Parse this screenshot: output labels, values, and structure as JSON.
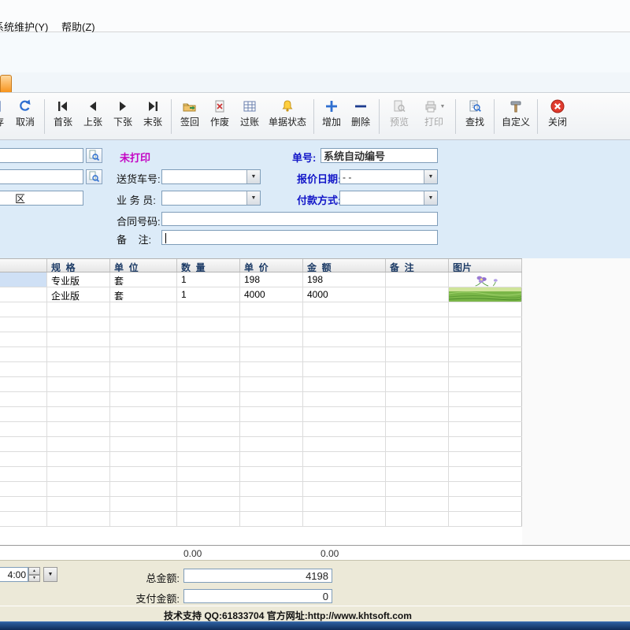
{
  "window": {
    "menu": [
      {
        "label": "系统维护(Y)"
      },
      {
        "label": "帮助(Z)"
      }
    ]
  },
  "toolbar": {
    "buttons": [
      {
        "id": "save",
        "label": "保存",
        "icon": "floppy-icon",
        "enabled": true
      },
      {
        "id": "cancel",
        "label": "取消",
        "icon": "undo-arrow-icon",
        "enabled": true
      },
      {
        "id": "first",
        "label": "首张",
        "icon": "first-record-icon",
        "enabled": true
      },
      {
        "id": "prev",
        "label": "上张",
        "icon": "prev-record-icon",
        "enabled": true
      },
      {
        "id": "next",
        "label": "下张",
        "icon": "next-record-icon",
        "enabled": true
      },
      {
        "id": "last",
        "label": "末张",
        "icon": "last-record-icon",
        "enabled": true
      },
      {
        "id": "sign-back",
        "label": "签回",
        "icon": "folder-return-icon",
        "enabled": true
      },
      {
        "id": "void",
        "label": "作废",
        "icon": "void-document-icon",
        "enabled": true
      },
      {
        "id": "post",
        "label": "过账",
        "icon": "ledger-grid-icon",
        "enabled": true
      },
      {
        "id": "doc-status",
        "label": "单据状态",
        "icon": "bell-icon",
        "enabled": true
      },
      {
        "id": "add",
        "label": "增加",
        "icon": "plus-icon",
        "enabled": true
      },
      {
        "id": "delete",
        "label": "删除",
        "icon": "minus-icon",
        "enabled": true
      },
      {
        "id": "preview",
        "label": "预览",
        "icon": "preview-icon",
        "enabled": false
      },
      {
        "id": "print",
        "label": "打印",
        "icon": "printer-icon",
        "enabled": false
      },
      {
        "id": "find",
        "label": "查找",
        "icon": "search-document-icon",
        "enabled": true
      },
      {
        "id": "customize",
        "label": "自定义",
        "icon": "hammer-icon",
        "enabled": true
      },
      {
        "id": "close",
        "label": "关闭",
        "icon": "close-circle-icon",
        "enabled": true
      }
    ]
  },
  "form": {
    "print_status": "未打印",
    "order_no_label": "单号:",
    "order_no_value": "系统自动编号",
    "delivery_vehicle_label": "送货车号:",
    "quote_date_label": "报价日期:",
    "quote_date_value": "- -",
    "salesman_label": "业 务 员:",
    "payment_method_label": "付款方式:",
    "contract_no_label": "合同号码:",
    "remark_label": "备    注:",
    "region_partial_value": "区"
  },
  "grid": {
    "columns": [
      "",
      "规  格",
      "单  位",
      "数  量",
      "单  价",
      "金  额",
      "备  注",
      "图片"
    ],
    "rows": [
      {
        "spec": "专业版",
        "unit": "套",
        "qty": "1",
        "price": "198",
        "amount": "198",
        "remark": "",
        "image": "flower-thumbnail"
      },
      {
        "spec": "企业版",
        "unit": "套",
        "qty": "1",
        "price": "4000",
        "amount": "4000",
        "remark": "",
        "image": "grass-thumbnail"
      }
    ],
    "totals": {
      "qty_total": "0.00",
      "amount_total": "0.00"
    }
  },
  "footer": {
    "time_value": "4:00",
    "total_amount_label": "总金额:",
    "total_amount_value": "4198",
    "paid_amount_label": "支付金额:",
    "paid_amount_value": "0"
  },
  "statusbar": {
    "text": "技术支持 QQ:61833704 官方网址:http://www.khtsoft.com"
  },
  "icons": {
    "combo_arrow": "▼",
    "spinner_up": "▲",
    "spinner_down": "▼",
    "print_dropdown": "▼"
  },
  "colors": {
    "label_blue": "#1216c8",
    "status_magenta": "#c303c3",
    "selected_row": "#cfe0f5",
    "tab_orange": "#f7941d",
    "taskbar_navy": "#12305f"
  }
}
